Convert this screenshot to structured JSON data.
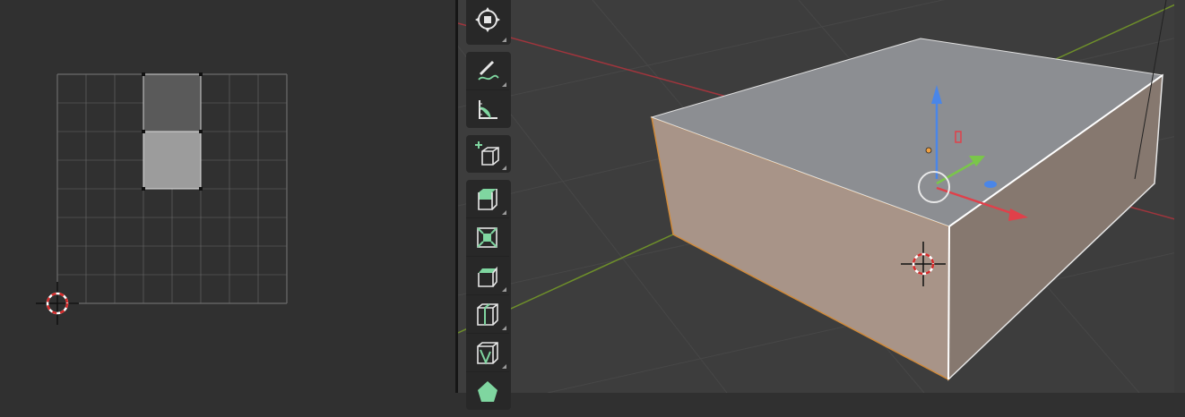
{
  "uv_editor": {
    "grid_color": "#6b6b6b",
    "selected_face_color": "#9a9a9a",
    "unselected_face_color": "#5c5c5c"
  },
  "viewport": {
    "background": "#3d3d3d",
    "x_axis_color": "#a0353d",
    "y_axis_color": "#6e8f2a",
    "object_top_color": "#8c8e92",
    "object_front_color": "#a89488",
    "object_side_color": "#86786f",
    "selection_outline_color": "#d08a3a"
  },
  "toolbar": {
    "tools": [
      {
        "icon": "transform-icon",
        "group": 1
      },
      {
        "icon": "annotate-icon",
        "group": 2
      },
      {
        "icon": "measure-icon",
        "group": 2
      },
      {
        "icon": "add-cube-icon",
        "group": 3
      },
      {
        "icon": "extrude-region-icon",
        "group": 4
      },
      {
        "icon": "inset-faces-icon",
        "group": 4
      },
      {
        "icon": "bevel-icon",
        "group": 4
      },
      {
        "icon": "loop-cut-icon",
        "group": 4
      },
      {
        "icon": "knife-icon",
        "group": 4
      },
      {
        "icon": "poly-build-icon",
        "group": 4
      }
    ]
  }
}
